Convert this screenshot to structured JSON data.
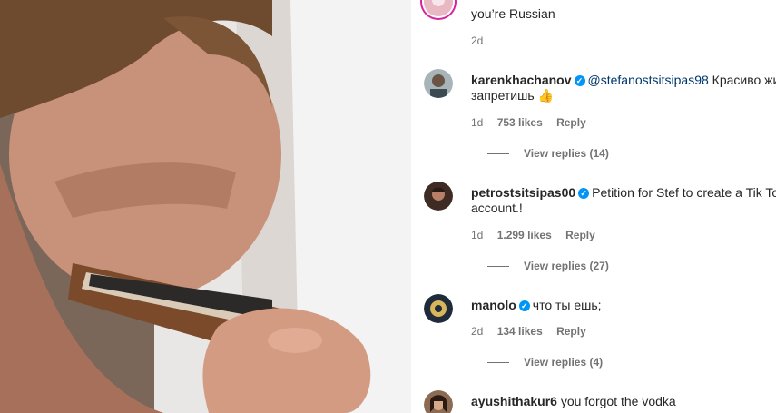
{
  "top_comment": {
    "text_line2": "you’re Russian",
    "time": "2d"
  },
  "comments": [
    {
      "username": "karenkhachanov",
      "mention": "@stefanostsitsipas98",
      "text_line1": " Красиво жить не запретишь ",
      "text_line2": "запретишь 👍",
      "time": "1d",
      "likes": "753 likes",
      "reply": "Reply",
      "view_replies": "View replies (14)"
    },
    {
      "username": "petrostsitsipas00",
      "text_line1": "Petition for Stef to create a Tik Tok",
      "text_line2": "account.!",
      "time": "1d",
      "likes": "1.299 likes",
      "reply": "Reply",
      "view_replies": "View replies (27)"
    },
    {
      "username": "manolo",
      "text_line1": "что ты ешь;",
      "time": "2d",
      "likes": "134 likes",
      "reply": "Reply",
      "view_replies": "View replies (4)"
    },
    {
      "username": "ayushithakur6",
      "text_line1": "you forgot the vodka"
    }
  ],
  "colors": {
    "verified": "#0095f6",
    "mention": "#00376b",
    "meta": "#737373"
  }
}
